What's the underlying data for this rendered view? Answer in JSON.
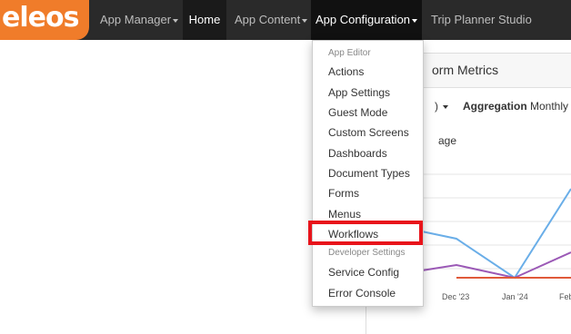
{
  "brand": {
    "logo_text": "eleos",
    "accent": "#f07c2a"
  },
  "nav": {
    "app_manager": "App Manager",
    "home": "Home",
    "app_content": "App Content",
    "app_configuration": "App Configuration",
    "trip_planner": "Trip Planner Studio"
  },
  "dropdown": {
    "header_app_editor": "App Editor",
    "actions": "Actions",
    "app_settings": "App Settings",
    "guest_mode": "Guest Mode",
    "custom_screens": "Custom Screens",
    "dashboards": "Dashboards",
    "document_types": "Document Types",
    "forms": "Forms",
    "menus": "Menus",
    "workflows": "Workflows",
    "header_developer": "Developer Settings",
    "service_config": "Service Config",
    "error_console": "Error Console",
    "highlight_color": "#e8141b"
  },
  "panel": {
    "title_fragment": "orm Metrics",
    "paren_fragment": ")",
    "aggregation_label": "Aggregation",
    "aggregation_value": "Monthly",
    "legend_fragment": "age"
  },
  "chart_data": {
    "type": "line",
    "categories": [
      "Dec '23",
      "Jan '24",
      "Feb"
    ],
    "series": [
      {
        "color": "#6aaee8",
        "values": [
          null,
          0,
          1
        ]
      },
      {
        "color": "#9b59b6",
        "values": [
          null,
          0,
          0.5
        ]
      },
      {
        "color": "#e05a3a",
        "values": [
          0,
          0,
          0
        ]
      }
    ]
  }
}
